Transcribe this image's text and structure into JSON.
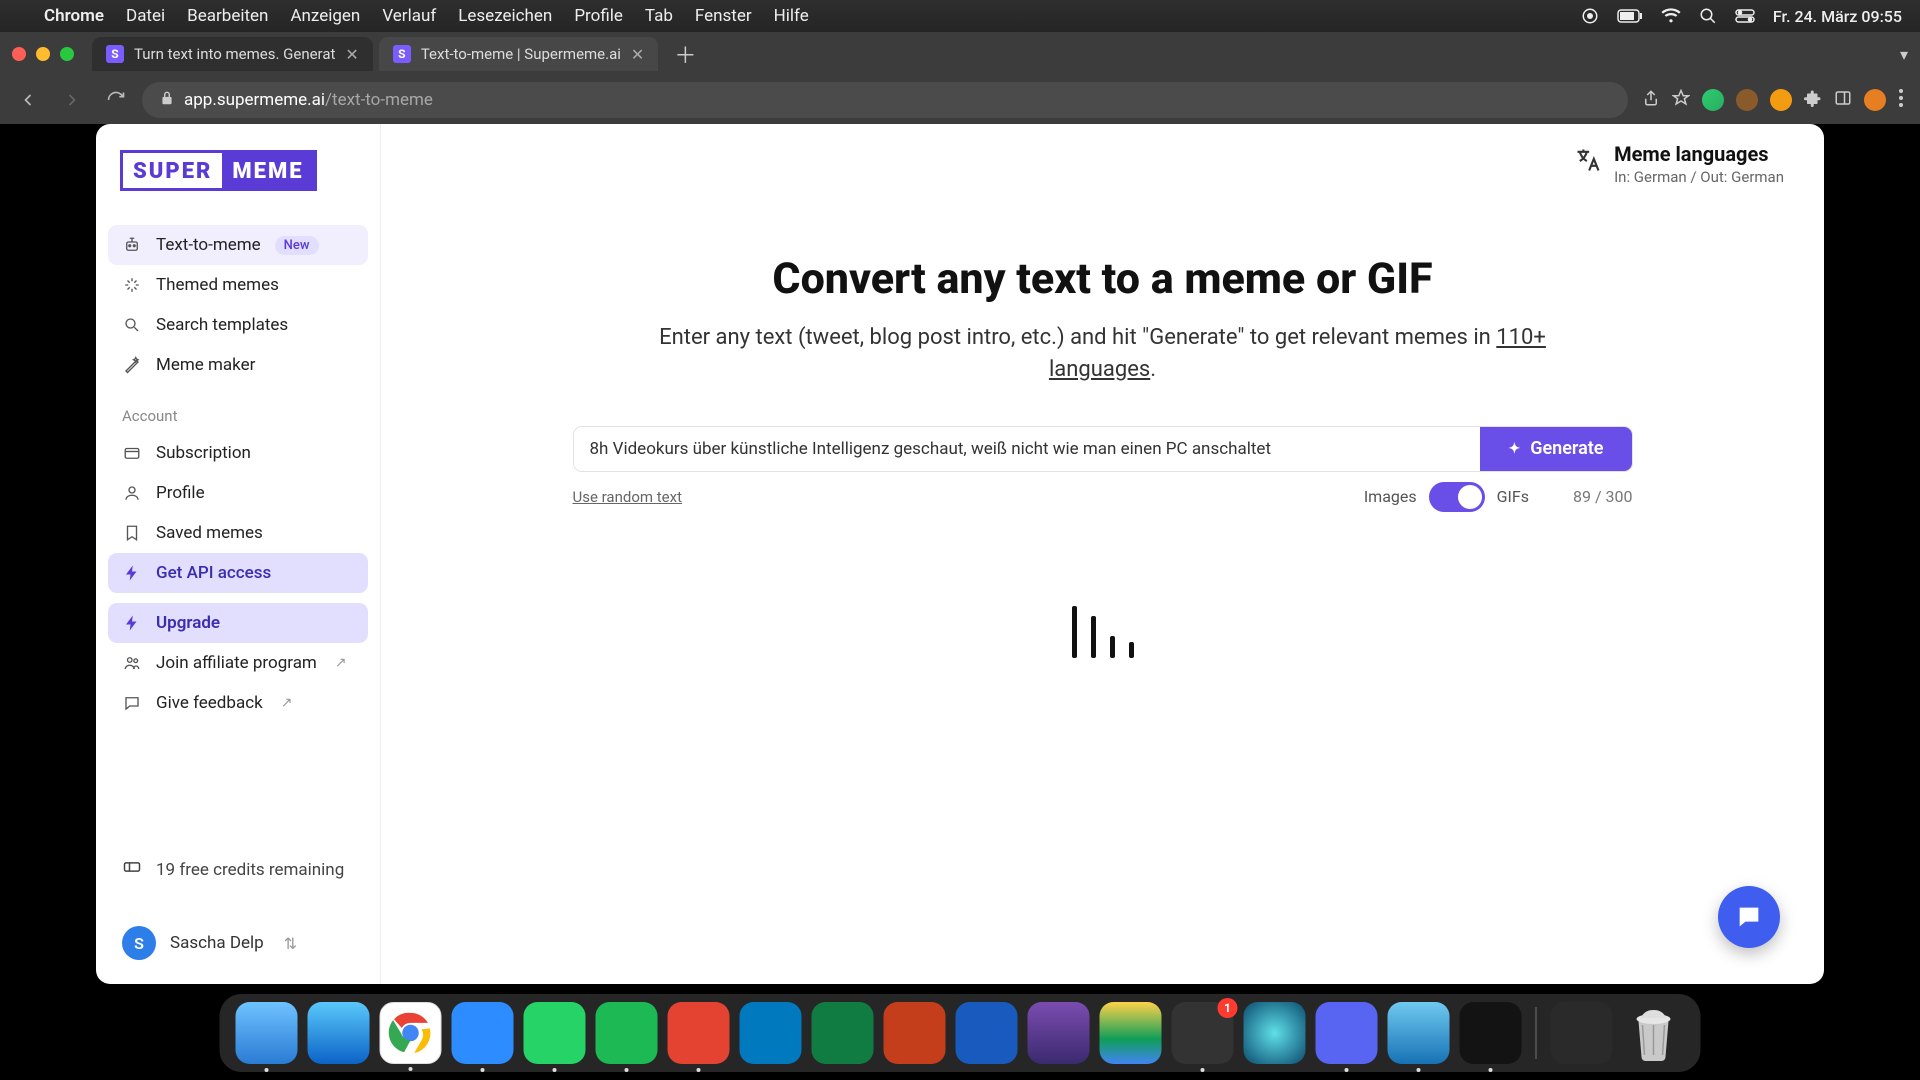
{
  "mac": {
    "app_name": "Chrome",
    "menus": [
      "Datei",
      "Bearbeiten",
      "Anzeigen",
      "Verlauf",
      "Lesezeichen",
      "Profile",
      "Tab",
      "Fenster",
      "Hilfe"
    ],
    "clock": "Fr. 24. März  09:55"
  },
  "tabs": {
    "t1": {
      "title": "Turn text into memes. Generat",
      "fav": "S"
    },
    "t2": {
      "title": "Text-to-meme | Supermeme.ai",
      "fav": "S"
    }
  },
  "url": {
    "domain": "app.supermeme.ai",
    "path": "/text-to-meme"
  },
  "logo": {
    "a": "SUPER",
    "b": "MEME"
  },
  "nav": {
    "text_to_meme": "Text-to-meme",
    "new_badge": "New",
    "themed": "Themed memes",
    "search_tpl": "Search templates",
    "maker": "Meme maker",
    "account_label": "Account",
    "subscription": "Subscription",
    "profile": "Profile",
    "saved": "Saved memes",
    "api": "Get API access",
    "upgrade": "Upgrade",
    "affiliate": "Join affiliate program",
    "feedback": "Give feedback",
    "credits": "19 free credits remaining"
  },
  "user": {
    "initial": "S",
    "name": "Sascha Delp"
  },
  "lang_panel": {
    "title": "Meme languages",
    "sub": "In: German / Out: German"
  },
  "hero": {
    "h1": "Convert any text to a meme or GIF",
    "lead_a": "Enter any text (tweet, blog post intro, etc.) and hit \"Generate\" to get relevant memes in ",
    "lang_link": "110+ languages",
    "lead_b": "."
  },
  "gen": {
    "input_value": "8h Videokurs über künstliche Intelligenz geschaut, weiß nicht wie man einen PC anschaltet",
    "button": "Generate",
    "random": "Use random text",
    "images": "Images",
    "gifs": "GIFs",
    "count": "89 / 300"
  },
  "dock_badge": "1"
}
